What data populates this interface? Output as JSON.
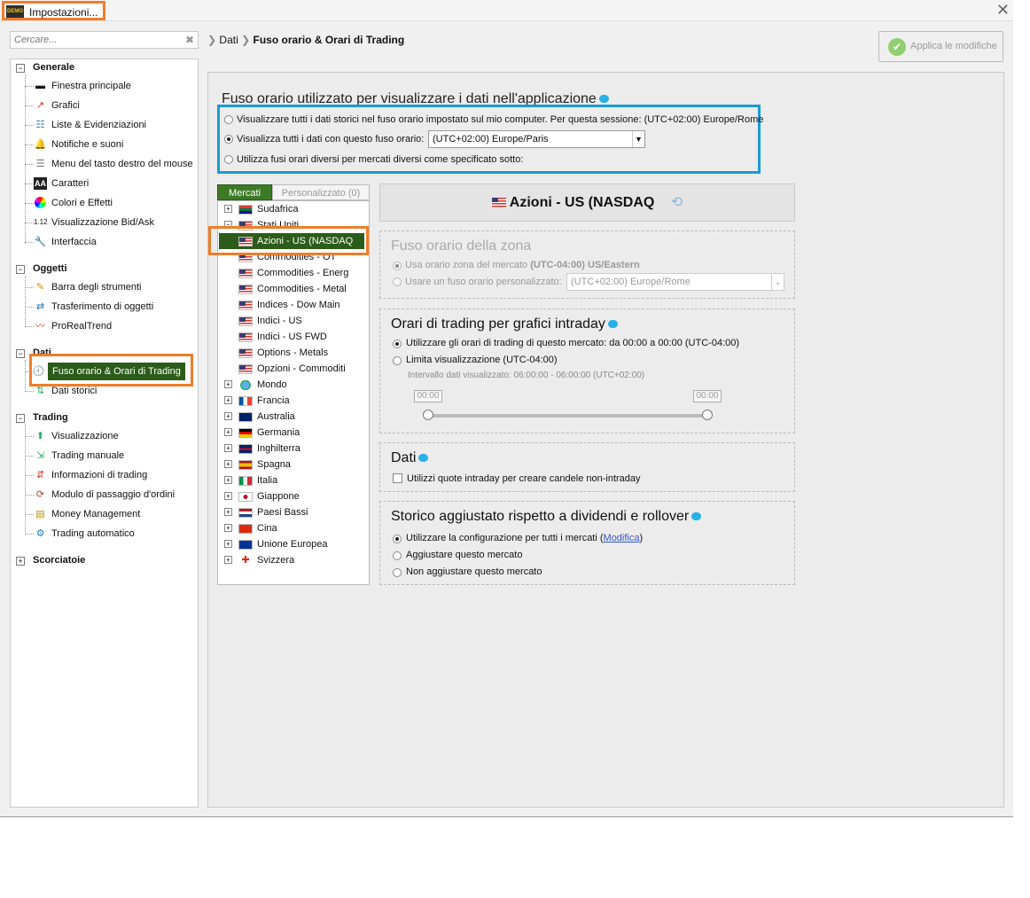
{
  "window": {
    "title": "Impostazioni...",
    "logo_text": "DEMO"
  },
  "search": {
    "placeholder": "Cercare..."
  },
  "breadcrumb": {
    "parent": "Dati",
    "current": "Fuso orario & Orari di Trading"
  },
  "apply_button": {
    "label": "Applica le modifiche"
  },
  "sidebar": {
    "sections": [
      {
        "label": "Generale",
        "items": [
          "Finestra principale",
          "Grafici",
          "Liste & Evidenziazioni",
          "Notifiche e suoni",
          "Menu del tasto destro del mouse",
          "Caratteri",
          "Colori e Effetti",
          "Visualizzazione Bid/Ask",
          "Interfaccia"
        ]
      },
      {
        "label": "Oggetti",
        "items": [
          "Barra degli strumenti",
          "Trasferimento di oggetti",
          "ProRealTrend"
        ]
      },
      {
        "label": "Dati",
        "items": [
          "Fuso orario & Orari di Trading",
          "Dati storici"
        ]
      },
      {
        "label": "Trading",
        "items": [
          "Visualizzazione",
          "Trading manuale",
          "Informazioni di trading",
          "Modulo di passaggio d'ordini",
          "Money Management",
          "Trading automatico"
        ]
      },
      {
        "label": "Scorciatoie",
        "items": []
      }
    ],
    "caratteri_icon_text": "AA",
    "bidask_icon_text": "1.12"
  },
  "timezone_section": {
    "title": "Fuso orario utilizzato per visualizzare i dati nell'applicazione",
    "option1": "Visualizzare tutti i dati storici nel fuso orario impostato sul mio computer. Per questa sessione: (UTC+02:00) Europe/Rome",
    "option2": "Visualizza tutti i dati con questo fuso orario:",
    "option2_value": "(UTC+02:00) Europe/Paris",
    "option3": "Utilizza fusi orari diversi per mercati diversi come specificato sotto:"
  },
  "market_tabs": {
    "active": "Mercati",
    "inactive": "Personalizzato (0)"
  },
  "tree": {
    "top": [
      "Sudafrica",
      "Stati Uniti"
    ],
    "us_children": [
      "Azioni - US (NASDAQ",
      "Commodities - OT",
      "Commodities - Energ",
      "Commodities - Metal",
      "Indices - Dow Main",
      "Indici - US",
      "Indici - US FWD",
      "Options - Metals",
      "Opzioni - Commoditi"
    ],
    "countries": [
      "Mondo",
      "Francia",
      "Australia",
      "Germania",
      "Inghilterra",
      "Spagna",
      "Italia",
      "Giappone",
      "Paesi Bassi",
      "Cina",
      "Unione Europea",
      "Svizzera"
    ]
  },
  "market_header": {
    "title": "Azioni - US (NASDAQ",
    "refresh_icon": "refresh-icon"
  },
  "zone_box": {
    "title": "Fuso orario della zona",
    "opt1_prefix": "Usa orario zona del mercato ",
    "opt1_bold": "(UTC-04:00) US/Eastern",
    "opt2": "Usare un fuso orario personalizzato:",
    "opt2_value": "(UTC+02:00) Europe/Rome"
  },
  "trading_hours_box": {
    "title": "Orari di trading per grafici intraday",
    "opt1": "Utilizzare gli orari di trading di questo mercato: da 00:00 a 00:00 (UTC-04:00)",
    "opt2": "Limita visualizzazione  (UTC-04:00)",
    "interval": "Intervallo dati visualizzato: 06:00:00 - 06:00:00 (UTC+02:00)",
    "slider_start": "00:00",
    "slider_end": "00:00"
  },
  "dati_box": {
    "title": "Dati",
    "checkbox": "Utilizzi quote intraday per creare candele non-intraday"
  },
  "storico_box": {
    "title": "Storico aggiustato rispetto a dividendi e rollover",
    "opt1_prefix": "Utilizzare la configurazione per tutti i mercati (",
    "opt1_link": "Modifica",
    "opt1_suffix": ")",
    "opt2": "Aggiustare questo mercato",
    "opt3": "Non aggiustare questo mercato"
  },
  "colors": {
    "accent_orange": "#f07d2a",
    "accent_blue": "#1a9bd7",
    "selected_green": "#2b5c19"
  }
}
